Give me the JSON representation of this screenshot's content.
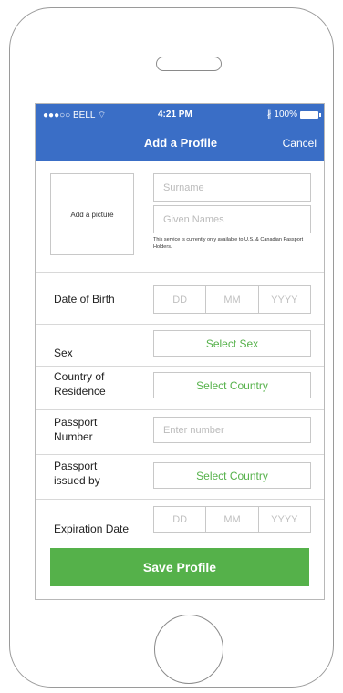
{
  "status": {
    "carrier": "●●●○○ BELL ⌔",
    "time": "4:21 PM",
    "battery": "∦ 100%"
  },
  "nav": {
    "title": "Add a Profile",
    "cancel": "Cancel"
  },
  "profile": {
    "picture_label": "Add a picture",
    "surname_placeholder": "Surname",
    "given_names_placeholder": "Given Names",
    "note": "This service is currently only available to U.S. & Canadian Passport Holders."
  },
  "dob": {
    "label": "Date of Birth",
    "dd": "DD",
    "mm": "MM",
    "yyyy": "YYYY"
  },
  "sex": {
    "label": "Sex",
    "button": "Select Sex"
  },
  "country": {
    "label": "Country of Residence",
    "button": "Select Country"
  },
  "passport_number": {
    "label": "Passport Number",
    "placeholder": "Enter number"
  },
  "passport_issued": {
    "label": "Passport issued by",
    "button": "Select Country"
  },
  "expiration": {
    "label": "Expiration Date",
    "dd": "DD",
    "mm": "MM",
    "yyyy": "YYYY"
  },
  "save_button": "Save Profile",
  "colors": {
    "accent": "#3a6ec6",
    "green": "#55b14a"
  }
}
